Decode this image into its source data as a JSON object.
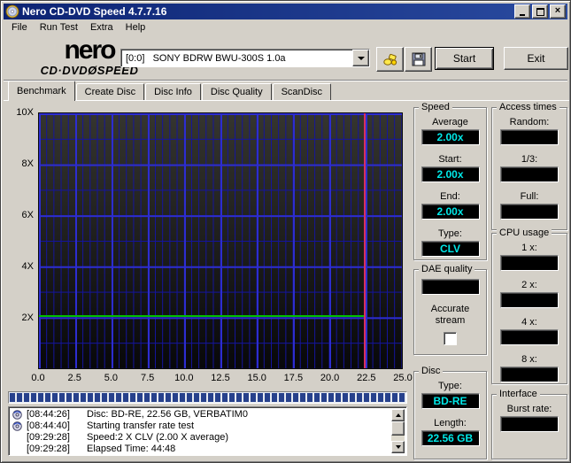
{
  "window": {
    "title": "Nero CD-DVD Speed 4.7.7.16"
  },
  "menu": {
    "items": [
      {
        "label": "File"
      },
      {
        "label": "Run Test"
      },
      {
        "label": "Extra"
      },
      {
        "label": "Help"
      }
    ]
  },
  "header": {
    "logo_line1": "nero",
    "logo_line2": "CD·DVDØSPEED",
    "drive_select": "[0:0]   SONY BDRW BWU-300S 1.0a",
    "start_label": "Start",
    "exit_label": "Exit"
  },
  "icons": {
    "close": "×",
    "minimize": "minimize-bar",
    "maximize": "window-outline",
    "drive_combo_arrow": "triangle-down",
    "scroll_up": "triangle-up",
    "scroll_down": "triangle-down",
    "toolbar": [
      "options-icon",
      "save-icon"
    ],
    "log_entry": "disc-event-icon"
  },
  "tabs": [
    {
      "label": "Benchmark",
      "active": true
    },
    {
      "label": "Create Disc",
      "active": false
    },
    {
      "label": "Disc Info",
      "active": false
    },
    {
      "label": "Disc Quality",
      "active": false
    },
    {
      "label": "ScanDisc",
      "active": false
    }
  ],
  "chart_data": {
    "type": "line",
    "xlim": [
      0,
      25
    ],
    "ylim": [
      0,
      10
    ],
    "x_ticks": [
      {
        "label": "0.0",
        "value": 0
      },
      {
        "label": "2.5",
        "value": 2.5
      },
      {
        "label": "5.0",
        "value": 5
      },
      {
        "label": "7.5",
        "value": 7.5
      },
      {
        "label": "10.0",
        "value": 10
      },
      {
        "label": "12.5",
        "value": 12.5
      },
      {
        "label": "15.0",
        "value": 15
      },
      {
        "label": "17.5",
        "value": 17.5
      },
      {
        "label": "20.0",
        "value": 20
      },
      {
        "label": "22.5",
        "value": 22.5
      },
      {
        "label": "25.0",
        "value": 25
      }
    ],
    "y_ticks": [
      {
        "label": "10X",
        "value": 10
      },
      {
        "label": "8X",
        "value": 8
      },
      {
        "label": "6X",
        "value": 6
      },
      {
        "label": "4X",
        "value": 4
      },
      {
        "label": "2X",
        "value": 2
      }
    ],
    "grid": true,
    "series": [
      {
        "name": "transfer-rate",
        "color": "#00c000",
        "x": [
          0,
          22.4
        ],
        "y": [
          2.0,
          2.0
        ]
      }
    ],
    "cursor_x": 22.4
  },
  "progress": {
    "percent": 100
  },
  "log": {
    "entries": [
      {
        "icon": true,
        "time": "[08:44:26]",
        "text": "Disc: BD-RE, 22.56 GB, VERBATIM0"
      },
      {
        "icon": true,
        "time": "[08:44:40]",
        "text": "Starting transfer rate test"
      },
      {
        "icon": false,
        "time": "[09:29:28]",
        "text": "Speed:2 X CLV (2.00 X average)"
      },
      {
        "icon": false,
        "time": "[09:29:28]",
        "text": "Elapsed Time: 44:48"
      }
    ]
  },
  "panels": {
    "speed": {
      "title": "Speed",
      "fields": [
        {
          "label": "Average",
          "value": "2.00x"
        },
        {
          "label": "Start:",
          "value": "2.00x"
        },
        {
          "label": "End:",
          "value": "2.00x"
        },
        {
          "label": "Type:",
          "value": "CLV"
        }
      ]
    },
    "access_times": {
      "title": "Access times",
      "fields": [
        {
          "label": "Random:",
          "value": ""
        },
        {
          "label": "1/3:",
          "value": ""
        },
        {
          "label": "Full:",
          "value": ""
        }
      ]
    },
    "dae": {
      "title": "DAE quality",
      "value": "",
      "checkbox_label": "Accurate stream",
      "checked": false
    },
    "cpu": {
      "title": "CPU usage",
      "fields": [
        {
          "label": "1 x:",
          "value": ""
        },
        {
          "label": "2 x:",
          "value": ""
        },
        {
          "label": "4 x:",
          "value": ""
        },
        {
          "label": "8 x:",
          "value": ""
        }
      ]
    },
    "disc": {
      "title": "Disc",
      "fields": [
        {
          "label": "Type:",
          "value": "BD-RE"
        },
        {
          "label": "Length:",
          "value": "22.56 GB"
        }
      ]
    },
    "interface": {
      "title": "Interface",
      "fields": [
        {
          "label": "Burst rate:",
          "value": ""
        }
      ]
    }
  },
  "colors": {
    "value_text": "#00e8e8",
    "speed_line": "#00c000",
    "cursor_line": "#d83060",
    "grid_major": "#2d2dd0",
    "grid_minor": "#1414a0",
    "titlebar_left": "#0c2373",
    "titlebar_right": "#2a4ba0"
  }
}
